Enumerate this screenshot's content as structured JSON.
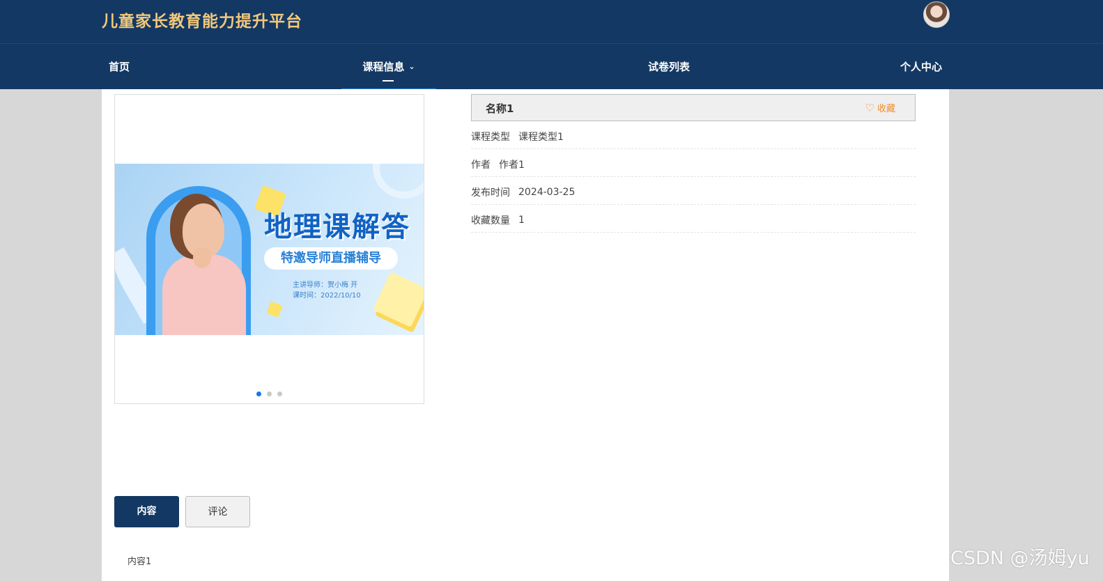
{
  "header": {
    "site_title": "儿童家长教育能力提升平台"
  },
  "nav": {
    "home": "首页",
    "course_info": "课程信息",
    "exam_list": "试卷列表",
    "profile": "个人中心"
  },
  "carousel": {
    "slide_title": "地理课解答",
    "slide_subtitle": "特邀导师直播辅导",
    "slide_line1": "主讲导师：贺小梅 开",
    "slide_line2": "课时间：2022/10/10",
    "dot_count": 3,
    "active_dot": 0
  },
  "detail": {
    "name": "名称1",
    "favorite_label": "收藏",
    "rows": [
      {
        "label": "课程类型",
        "value": "课程类型1"
      },
      {
        "label": "作者",
        "value": "作者1"
      },
      {
        "label": "发布时间",
        "value": "2024-03-25"
      },
      {
        "label": "收藏数量",
        "value": "1"
      }
    ]
  },
  "tabs": {
    "content": "内容",
    "comment": "评论"
  },
  "content_text": "内容1",
  "watermark": "CSDN @汤姆yu",
  "colors": {
    "header_bg": "#133863",
    "title_gold": "#f3c87a",
    "fav_orange": "#f08c2a"
  }
}
